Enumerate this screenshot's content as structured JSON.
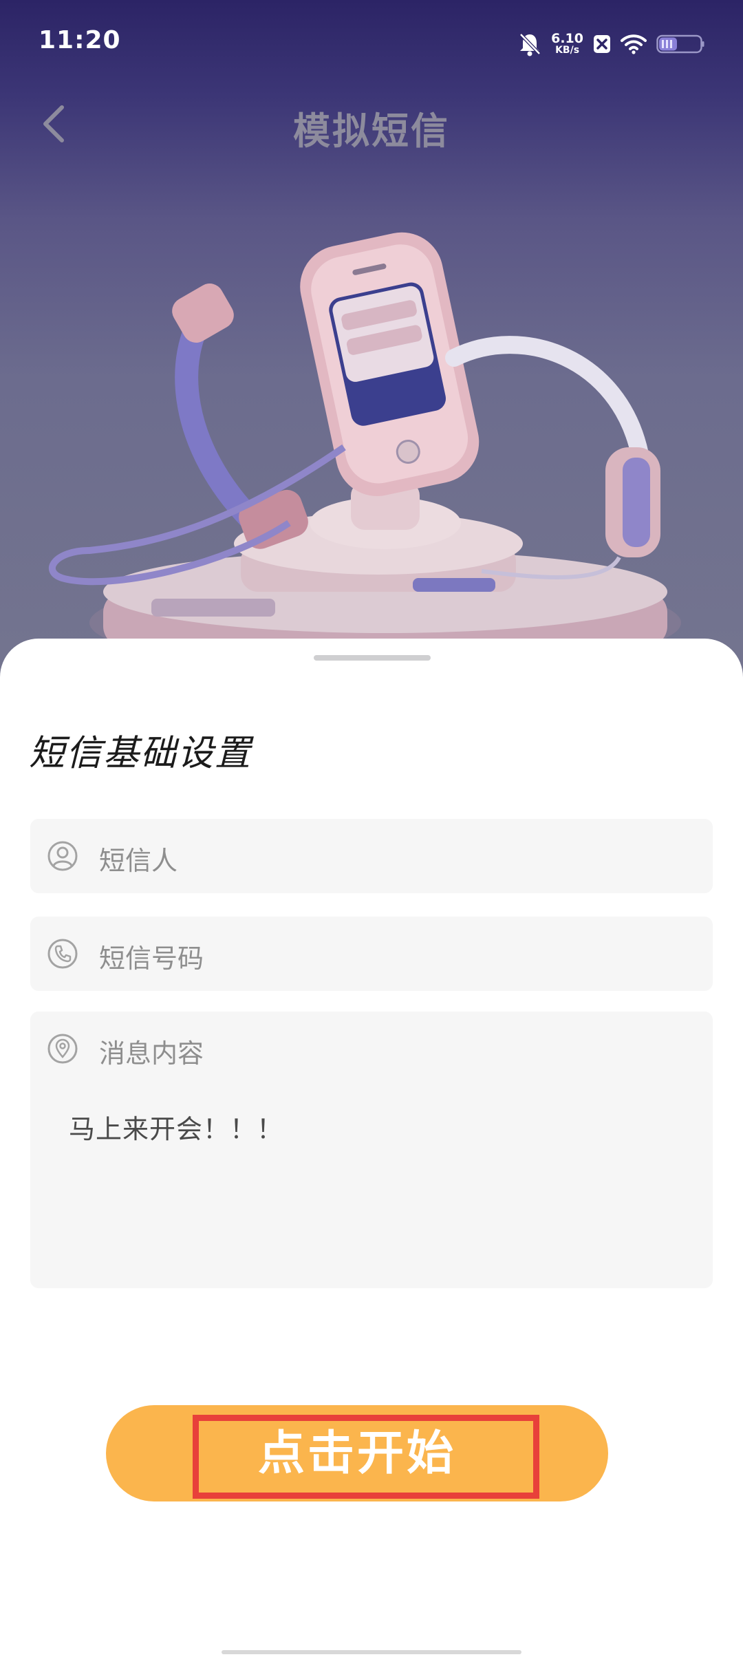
{
  "status_bar": {
    "time": "11:20",
    "net_speed_value": "6.10",
    "net_speed_unit": "KB/s",
    "icons": [
      "bell-muted-icon",
      "x-badge-icon",
      "wifi-icon",
      "battery-icon"
    ]
  },
  "nav": {
    "title": "模拟短信",
    "back_icon": "chevron-left-icon"
  },
  "hero": {
    "illustration": "phone-and-headset-illustration"
  },
  "form": {
    "section_title": "短信基础设置",
    "sender": {
      "placeholder": "短信人",
      "icon": "user-circle-icon"
    },
    "phone": {
      "placeholder": "短信号码",
      "icon": "phone-icon"
    },
    "message": {
      "placeholder": "消息内容",
      "icon": "location-pin-icon",
      "value": "马上来开会！！！"
    }
  },
  "actions": {
    "start_label": "点击开始"
  },
  "colors": {
    "accent": "#fbb54d",
    "highlight": "#e8403a",
    "field_bg": "#f6f6f6",
    "header_bg": "#2c2466"
  }
}
